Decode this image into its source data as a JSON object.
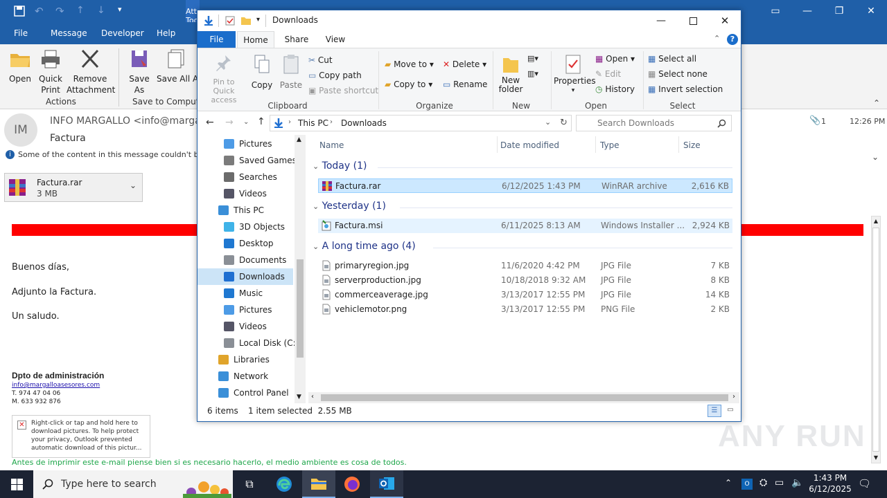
{
  "outlook": {
    "title_tab": "Attachment Tools",
    "menu": [
      "File",
      "Message",
      "Developer",
      "Help"
    ],
    "ribbon": {
      "open": "Open",
      "quick_print": "Quick Print",
      "remove_attachment": "Remove Attachment",
      "actions_group": "Actions",
      "save_as": "Save As",
      "save_all": "Save All Attachmen",
      "save_group": "Save to Computer"
    },
    "sender_initials": "IM",
    "sender": "INFO MARGALLO <info@margal",
    "subject": "Factura",
    "warning": "Some of the content in this message couldn't be c",
    "attachment_count": "1",
    "time": "12:26 PM",
    "attachment": {
      "name": "Factura.rar",
      "size": "3 MB"
    },
    "body": [
      "Buenos días,",
      "Adjunto la Factura.",
      "Un saludo."
    ],
    "sig_name": "Dpto de administración",
    "sig_email": "info@margalloasesores.com",
    "sig_phone": "T. 974 47 04 06",
    "sig_mobile": "M. 633 932 876",
    "image_placeholder": "Right-click or tap and hold here to download pictures. To help protect your privacy, Outlook prevented automatic download of this pictur...",
    "footer_green": "Antes de imprimir este e-mail piense bien si es necesario hacerlo, el medio ambiente es cosa de todos."
  },
  "explorer": {
    "title": "Downloads",
    "tabs": [
      "File",
      "Home",
      "Share",
      "View"
    ],
    "ribbon": {
      "pin": "Pin to Quick access",
      "copy": "Copy",
      "paste": "Paste",
      "cut": "Cut",
      "copy_path": "Copy path",
      "paste_shortcut": "Paste shortcut",
      "clipboard": "Clipboard",
      "move_to": "Move to",
      "copy_to": "Copy to",
      "delete": "Delete",
      "rename": "Rename",
      "organize": "Organize",
      "new_folder": "New folder",
      "new": "New",
      "properties": "Properties",
      "open": "Open",
      "edit": "Edit",
      "history": "History",
      "open_group": "Open",
      "select_all": "Select all",
      "select_none": "Select none",
      "invert": "Invert selection",
      "select_group": "Select"
    },
    "breadcrumb": [
      "This PC",
      "Downloads"
    ],
    "search_placeholder": "Search Downloads",
    "nav": [
      {
        "label": "Pictures",
        "icon": "pictures-icon",
        "indent": 1
      },
      {
        "label": "Saved Games",
        "icon": "saved-games-icon",
        "indent": 1
      },
      {
        "label": "Searches",
        "icon": "searches-icon",
        "indent": 1
      },
      {
        "label": "Videos",
        "icon": "videos-icon",
        "indent": 1
      },
      {
        "label": "This PC",
        "icon": "this-pc-icon",
        "indent": 0
      },
      {
        "label": "3D Objects",
        "icon": "3d-objects-icon",
        "indent": 1
      },
      {
        "label": "Desktop",
        "icon": "desktop-icon",
        "indent": 1
      },
      {
        "label": "Documents",
        "icon": "documents-icon",
        "indent": 1
      },
      {
        "label": "Downloads",
        "icon": "downloads-icon",
        "indent": 1,
        "selected": true
      },
      {
        "label": "Music",
        "icon": "music-icon",
        "indent": 1
      },
      {
        "label": "Pictures",
        "icon": "pictures-icon",
        "indent": 1
      },
      {
        "label": "Videos",
        "icon": "videos-icon",
        "indent": 1
      },
      {
        "label": "Local Disk (C:)",
        "icon": "disk-icon",
        "indent": 1
      },
      {
        "label": "Libraries",
        "icon": "libraries-icon",
        "indent": 0
      },
      {
        "label": "Network",
        "icon": "network-icon",
        "indent": 0
      },
      {
        "label": "Control Panel",
        "icon": "control-panel-icon",
        "indent": 0
      }
    ],
    "columns": [
      "Name",
      "Date modified",
      "Type",
      "Size"
    ],
    "groups": [
      {
        "label": "Today (1)",
        "files": [
          {
            "name": "Factura.rar",
            "date": "6/12/2025 1:43 PM",
            "type": "WinRAR archive",
            "size": "2,616 KB",
            "icon": "winrar-icon",
            "selected": true
          }
        ]
      },
      {
        "label": "Yesterday (1)",
        "files": [
          {
            "name": "Factura.msi",
            "date": "6/11/2025 8:13 AM",
            "type": "Windows Installer ...",
            "size": "2,924 KB",
            "icon": "msi-icon",
            "hover": true
          }
        ]
      },
      {
        "label": "A long time ago (4)",
        "files": [
          {
            "name": "primaryregion.jpg",
            "date": "11/6/2020 4:42 PM",
            "type": "JPG File",
            "size": "7 KB",
            "icon": "jpg-icon"
          },
          {
            "name": "serverproduction.jpg",
            "date": "10/18/2018 9:32 AM",
            "type": "JPG File",
            "size": "8 KB",
            "icon": "jpg-icon"
          },
          {
            "name": "commerceaverage.jpg",
            "date": "3/13/2017 12:55 PM",
            "type": "JPG File",
            "size": "14 KB",
            "icon": "jpg-icon"
          },
          {
            "name": "vehiclemotor.png",
            "date": "3/13/2017 12:55 PM",
            "type": "PNG File",
            "size": "2 KB",
            "icon": "png-icon"
          }
        ]
      }
    ],
    "status_items": "6 items",
    "status_selected": "1 item selected  2.55 MB"
  },
  "taskbar": {
    "search_placeholder": "Type here to search",
    "time": "1:43 PM",
    "date": "6/12/2025"
  },
  "watermark": "ANY RUN"
}
